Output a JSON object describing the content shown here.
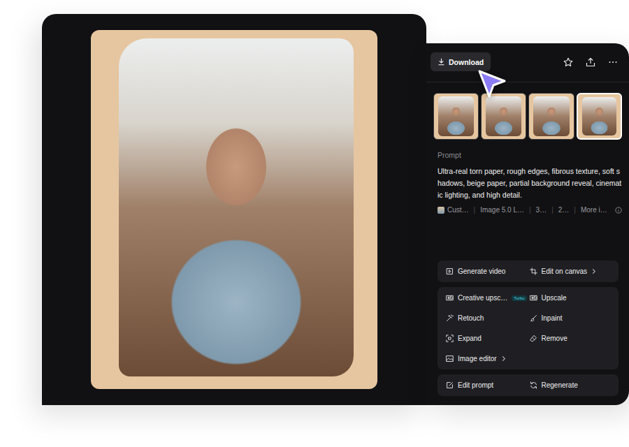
{
  "toolbar": {
    "download": "Download"
  },
  "thumbnails": [
    {
      "selected": false
    },
    {
      "selected": false
    },
    {
      "selected": false
    },
    {
      "selected": true
    }
  ],
  "prompt": {
    "label": "Prompt",
    "text": "Ultra-real torn paper, rough edges, fibrous texture, soft shadows, beige paper, partial background reveal, cinematic lighting, and high detail."
  },
  "meta": {
    "items": [
      "Cust…",
      "Image 5.0 L…",
      "3…",
      "2…"
    ],
    "separator": "|",
    "more": "More i…"
  },
  "action_groups": [
    [
      {
        "label": "Generate video",
        "submenu": false,
        "badge": ""
      },
      {
        "label": "Edit on canvas",
        "submenu": true,
        "badge": ""
      }
    ],
    [
      {
        "label": "Creative upsc…",
        "submenu": false,
        "badge": "Turbo"
      },
      {
        "label": "Upscale",
        "submenu": false,
        "badge": ""
      },
      {
        "label": "Retouch",
        "submenu": false,
        "badge": ""
      },
      {
        "label": "Inpaint",
        "submenu": false,
        "badge": ""
      },
      {
        "label": "Expand",
        "submenu": false,
        "badge": ""
      },
      {
        "label": "Remove",
        "submenu": false,
        "badge": ""
      },
      {
        "label": "Image editor",
        "submenu": true,
        "badge": ""
      }
    ],
    [
      {
        "label": "Edit prompt",
        "submenu": false,
        "badge": ""
      },
      {
        "label": "Regenerate",
        "submenu": false,
        "badge": ""
      }
    ]
  ]
}
